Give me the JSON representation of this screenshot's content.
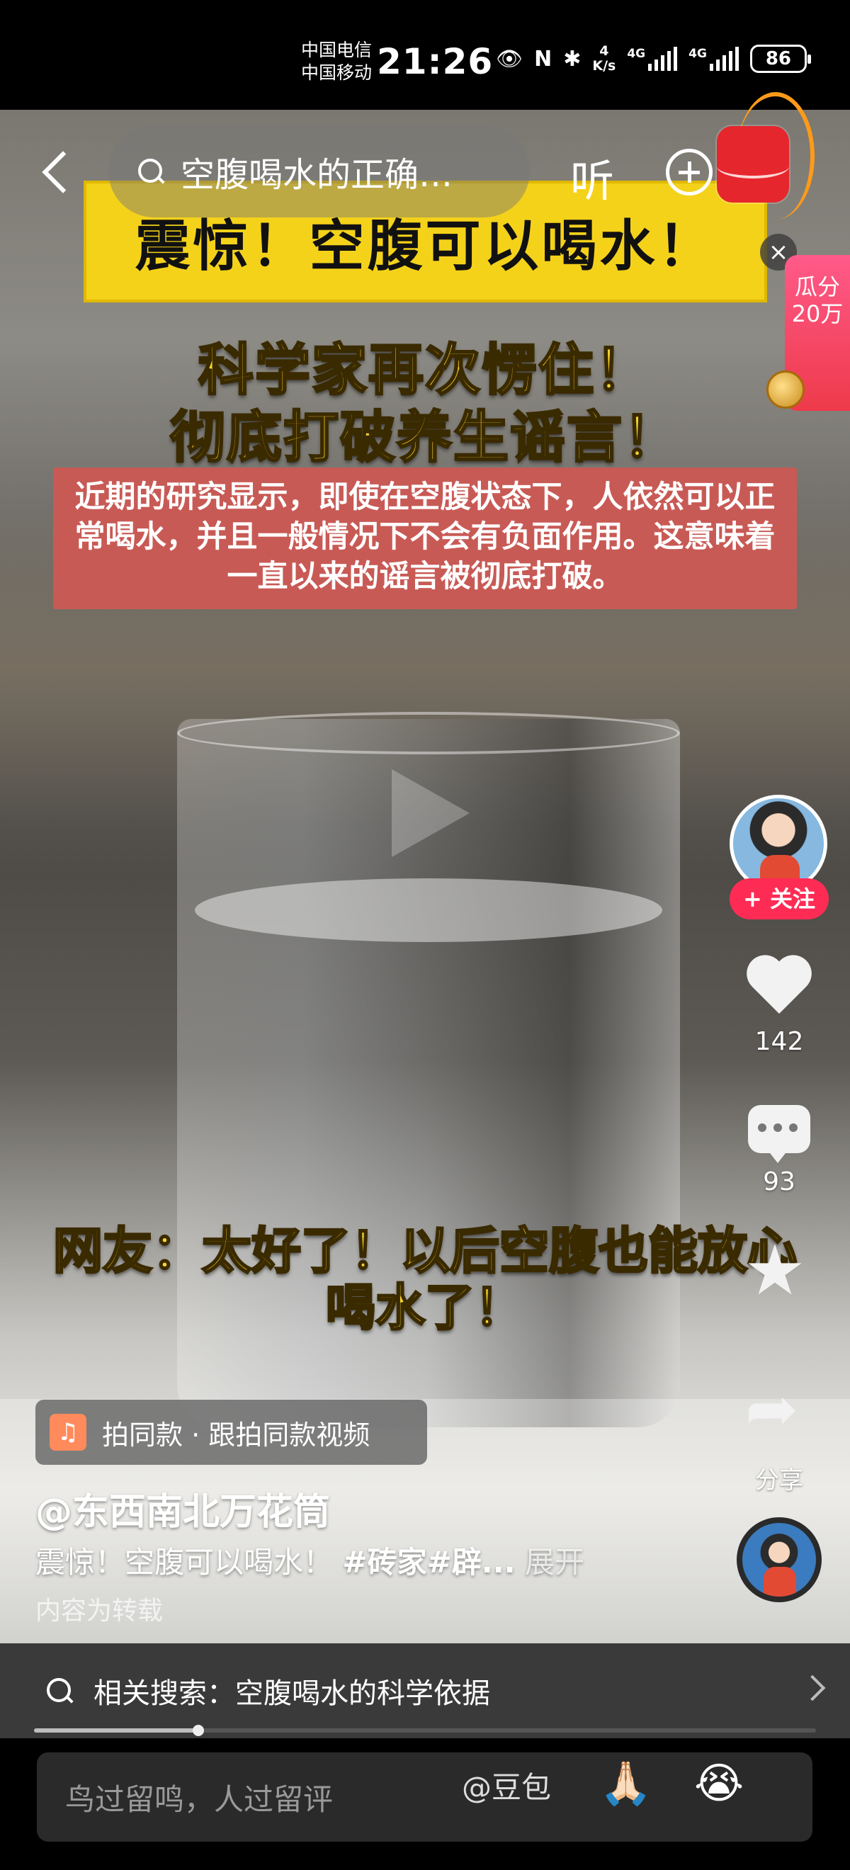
{
  "status_bar": {
    "carrier_1": "中国电信",
    "carrier_2": "中国移动",
    "time": "21:26",
    "net_speed_value": "4",
    "net_speed_unit": "K/s",
    "signal_1": "4G",
    "signal_2": "4G",
    "battery": "86"
  },
  "top_nav": {
    "search_query": "空腹喝水的正确…",
    "listen_label": "听"
  },
  "promo": {
    "close_label": "×",
    "tag_text": "瓜分20万"
  },
  "video_text": {
    "title_banner": "震惊！空腹可以喝水！",
    "headline_1": "科学家再次愣住！",
    "headline_2": "彻底打破养生谣言！",
    "body": "近期的研究显示，即使在空腹状态下，人依然可以正常喝水，并且一般情况下不会有负面作用。这意味着一直以来的谣言被彻底打破。",
    "caption_1": "网友：太好了！以后空腹也能放心",
    "caption_2": "喝水了！"
  },
  "right_rail": {
    "follow_label": "+ 关注",
    "likes": "142",
    "comments": "93",
    "share_label": "分享"
  },
  "info": {
    "collab_label": "拍同款 · 跟拍同款视频",
    "author": "@东西南北万花筒",
    "desc_text": "震惊！空腹可以喝水！",
    "desc_tags": "#砖家#辟...",
    "expand_label": "展开",
    "repost_note": "内容为转载"
  },
  "related_search": {
    "text": "相关搜索：空腹喝水的科学依据"
  },
  "playback": {
    "progress": 0.21
  },
  "comment_bar": {
    "placeholder": "鸟过留鸣，人过留评",
    "mention": "@豆包",
    "emoji_1": "🙏🏻",
    "emoji_2": "😭"
  }
}
